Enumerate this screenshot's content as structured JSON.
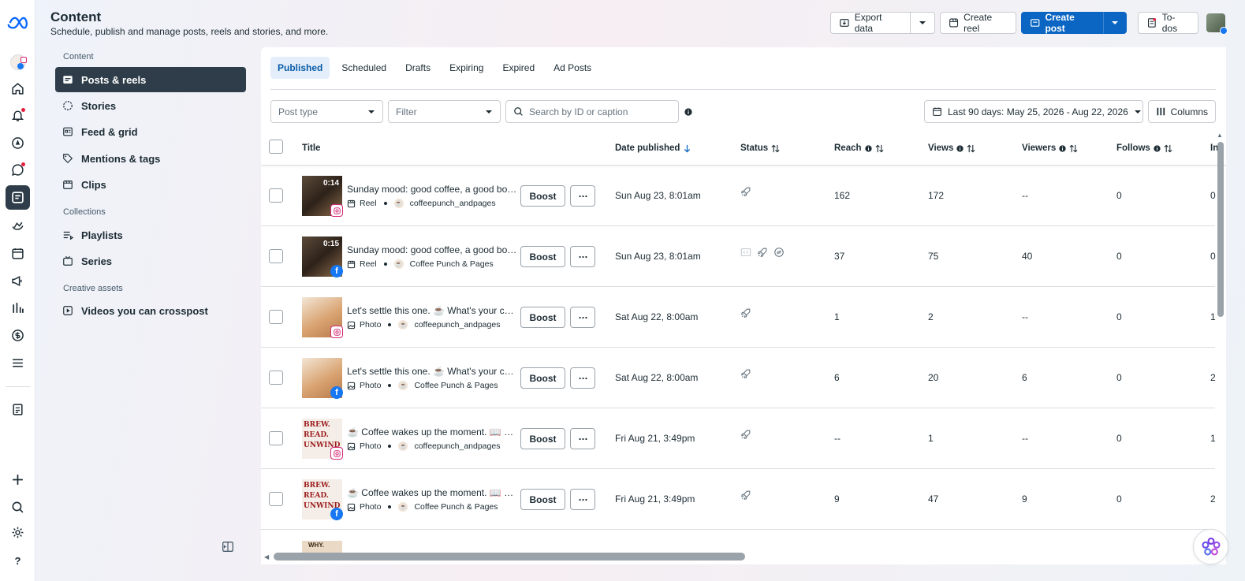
{
  "header": {
    "title": "Content",
    "subtitle": "Schedule, publish and manage posts, reels and stories, and more.",
    "buttons": {
      "export": "Export data",
      "create_reel": "Create reel",
      "create_post": "Create post",
      "todos": "To-dos"
    }
  },
  "sidebar": {
    "sections": [
      "Content",
      "Collections",
      "Creative assets"
    ],
    "items": [
      {
        "label": "Posts & reels",
        "icon": "posts-icon"
      },
      {
        "label": "Stories",
        "icon": "stories-icon"
      },
      {
        "label": "Feed & grid",
        "icon": "feed-grid-icon"
      },
      {
        "label": "Mentions & tags",
        "icon": "tag-icon"
      },
      {
        "label": "Clips",
        "icon": "clips-icon"
      },
      {
        "label": "Playlists",
        "icon": "playlist-icon"
      },
      {
        "label": "Series",
        "icon": "series-icon"
      },
      {
        "label": "Videos you can crosspost",
        "icon": "video-icon"
      }
    ]
  },
  "tabs": [
    "Published",
    "Scheduled",
    "Drafts",
    "Expiring",
    "Expired",
    "Ad Posts"
  ],
  "filters": {
    "post_type": "Post type",
    "filter": "Filter",
    "search_placeholder": "Search by ID or caption",
    "date_range": "Last 90 days: May 25, 2026 - Aug 22, 2026",
    "columns": "Columns"
  },
  "table": {
    "headers": {
      "title": "Title",
      "date": "Date published",
      "status": "Status",
      "reach": "Reach",
      "views": "Views",
      "viewers": "Viewers",
      "follows": "Follows",
      "cut": "In"
    },
    "boost_label": "Boost",
    "rows": [
      {
        "caption": "Sunday mood: good coffee, a good book and a cozy corner",
        "type": "Reel",
        "page": "coffeepunch_andpages",
        "platform": "instagram",
        "duration": "0:14",
        "date": "Sun Aug 23, 8:01am",
        "reach": "162",
        "views": "172",
        "viewers": "--",
        "follows": "0",
        "cut": "0"
      },
      {
        "caption": "Sunday mood: good coffee, a good book and a cozy corner",
        "type": "Reel",
        "page": "Coffee Punch & Pages",
        "platform": "facebook",
        "duration": "0:15",
        "date": "Sun Aug 23, 8:01am",
        "reach": "37",
        "views": "75",
        "viewers": "40",
        "follows": "0",
        "cut": "0"
      },
      {
        "caption": "Let's settle this one. ☕ What's your coffee order?",
        "type": "Photo",
        "page": "coffeepunch_andpages",
        "platform": "instagram",
        "date": "Sat Aug 22, 8:00am",
        "reach": "1",
        "views": "2",
        "viewers": "--",
        "follows": "0",
        "cut": "1"
      },
      {
        "caption": "Let's settle this one. ☕ What's your coffee order?",
        "type": "Photo",
        "page": "Coffee Punch & Pages",
        "platform": "facebook",
        "date": "Sat Aug 22, 8:00am",
        "reach": "6",
        "views": "20",
        "viewers": "6",
        "follows": "0",
        "cut": "2"
      },
      {
        "caption": "☕ Coffee wakes up the moment. 📖 Books wake up the mind.",
        "type": "Photo",
        "page": "coffeepunch_andpages",
        "platform": "instagram",
        "date": "Fri Aug 21, 3:49pm",
        "reach": "--",
        "views": "1",
        "viewers": "--",
        "follows": "0",
        "cut": "1"
      },
      {
        "caption": "☕ Coffee wakes up the moment. 📖 Books wake up the mind.",
        "type": "Photo",
        "page": "Coffee Punch & Pages",
        "platform": "facebook",
        "date": "Fri Aug 21, 3:49pm",
        "reach": "9",
        "views": "47",
        "viewers": "9",
        "follows": "0",
        "cut": "2"
      }
    ]
  },
  "thumb_text": {
    "brew": "BREW.",
    "read": "READ.",
    "unwind": "UNWIND",
    "why": "WHY."
  },
  "colors": {
    "accent": "#0a66c2",
    "active_nav": "#2e3d49",
    "notification": "#e41e3f"
  }
}
